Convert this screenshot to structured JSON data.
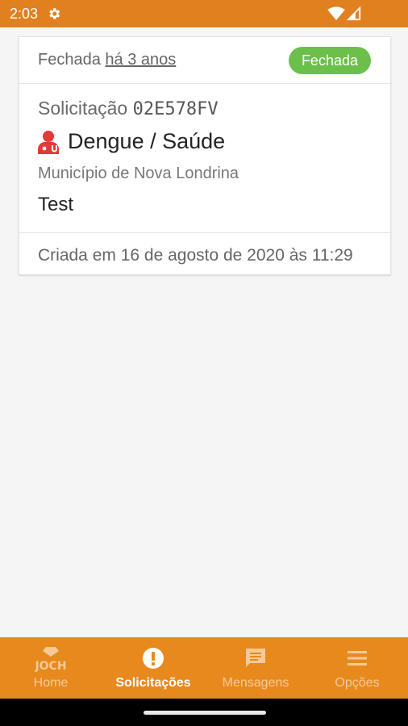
{
  "status_bar": {
    "time": "2:03",
    "icons": [
      "gear-icon",
      "wifi-icon",
      "signal-icon"
    ]
  },
  "card": {
    "header": {
      "closed_label": "Fechada",
      "closed_relative": "há 3 anos",
      "badge": "Fechada",
      "badge_color": "#6cbf4b"
    },
    "request_label": "Solicitação",
    "request_code": "02E578FV",
    "category_icon": "health-worker-icon",
    "category_color": "#e53935",
    "category": "Dengue / Saúde",
    "municipality": "Município de Nova Londrina",
    "description": "Test",
    "created": "Criada em 16 de agosto de 2020 às 11:29"
  },
  "bottom_nav": {
    "color": "#e8891e",
    "items": [
      {
        "label": "Home",
        "icon": "joch-logo-icon",
        "active": false
      },
      {
        "label": "Solicitações",
        "icon": "alert-icon",
        "active": true
      },
      {
        "label": "Mensagens",
        "icon": "message-icon",
        "active": false
      },
      {
        "label": "Opções",
        "icon": "menu-icon",
        "active": false
      }
    ],
    "home_logo_text": "JOCH"
  }
}
